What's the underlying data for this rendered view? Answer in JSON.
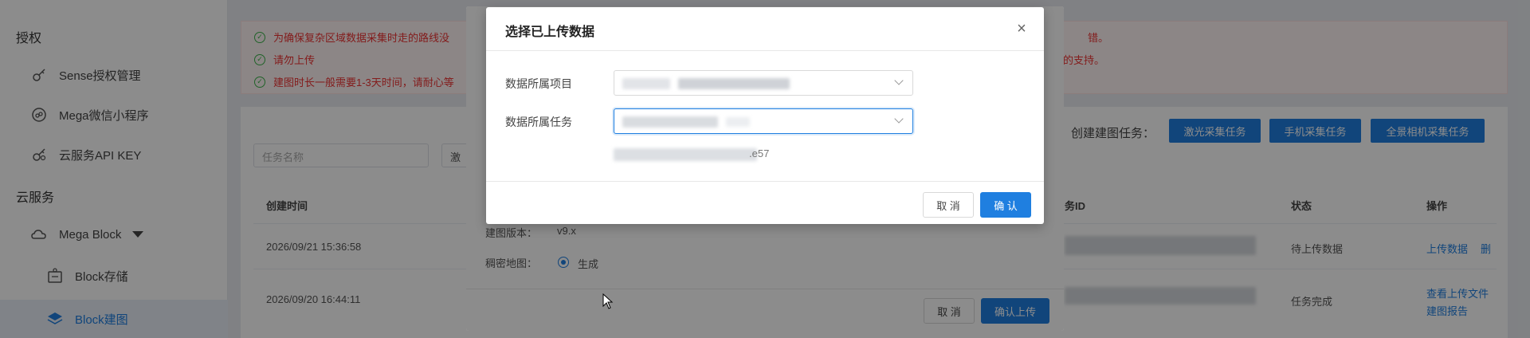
{
  "sidebar": {
    "group_auth": "授权",
    "items_auth": [
      {
        "label": "Sense授权管理",
        "icon": "key-icon"
      },
      {
        "label": "Mega微信小程序",
        "icon": "miniprogram-icon"
      },
      {
        "label": "云服务API KEY",
        "icon": "api-key-icon"
      }
    ],
    "group_cloud": "云服务",
    "mega_block": {
      "label": "Mega Block",
      "icon": "cloud-icon"
    },
    "block_storage": {
      "label": "Block存储",
      "icon": "storage-icon"
    },
    "block_build": {
      "label": "Block建图",
      "icon": "layers-icon"
    }
  },
  "notices": [
    {
      "text": "为确保复杂区域数据采集时走的路线没",
      "tail": "错。"
    },
    {
      "text": "请勿上传",
      "tail": "您的支持。"
    },
    {
      "text": "建图时长一般需要1-3天时间，请耐心等",
      "tail": ""
    }
  ],
  "toolbar": {
    "search_placeholder": "任务名称",
    "type_filter": "激",
    "create_label": "创建建图任务：",
    "btn_laser": "激光采集任务",
    "btn_phone": "手机采集任务",
    "btn_panorama": "全景相机采集任务"
  },
  "table": {
    "headers": {
      "created": "创建时间",
      "task_id": "务ID",
      "status": "状态",
      "action": "操作"
    },
    "rows": [
      {
        "created": "2026/09/21 15:36:58",
        "status": "待上传数据",
        "actions": [
          "上传数据",
          "删"
        ]
      },
      {
        "created": "2026/09/20 16:44:11",
        "status": "任务完成",
        "actions": [
          "查看上传文件",
          "建图报告"
        ]
      }
    ]
  },
  "upload_dialog": {
    "version_label": "建图版本：",
    "version_value": "v9.x",
    "dense_label": "稠密地图：",
    "dense_option": "生成",
    "cancel": "取 消",
    "confirm": "确认上传"
  },
  "select_dialog": {
    "title": "选择已上传数据",
    "project_label": "数据所属项目",
    "task_label": "数据所属任务",
    "hint_suffix": ".e57",
    "cancel": "取 消",
    "confirm": "确 认"
  },
  "colors": {
    "primary": "#1f7fe0",
    "error": "#ee3333",
    "success": "#3bb34a"
  }
}
